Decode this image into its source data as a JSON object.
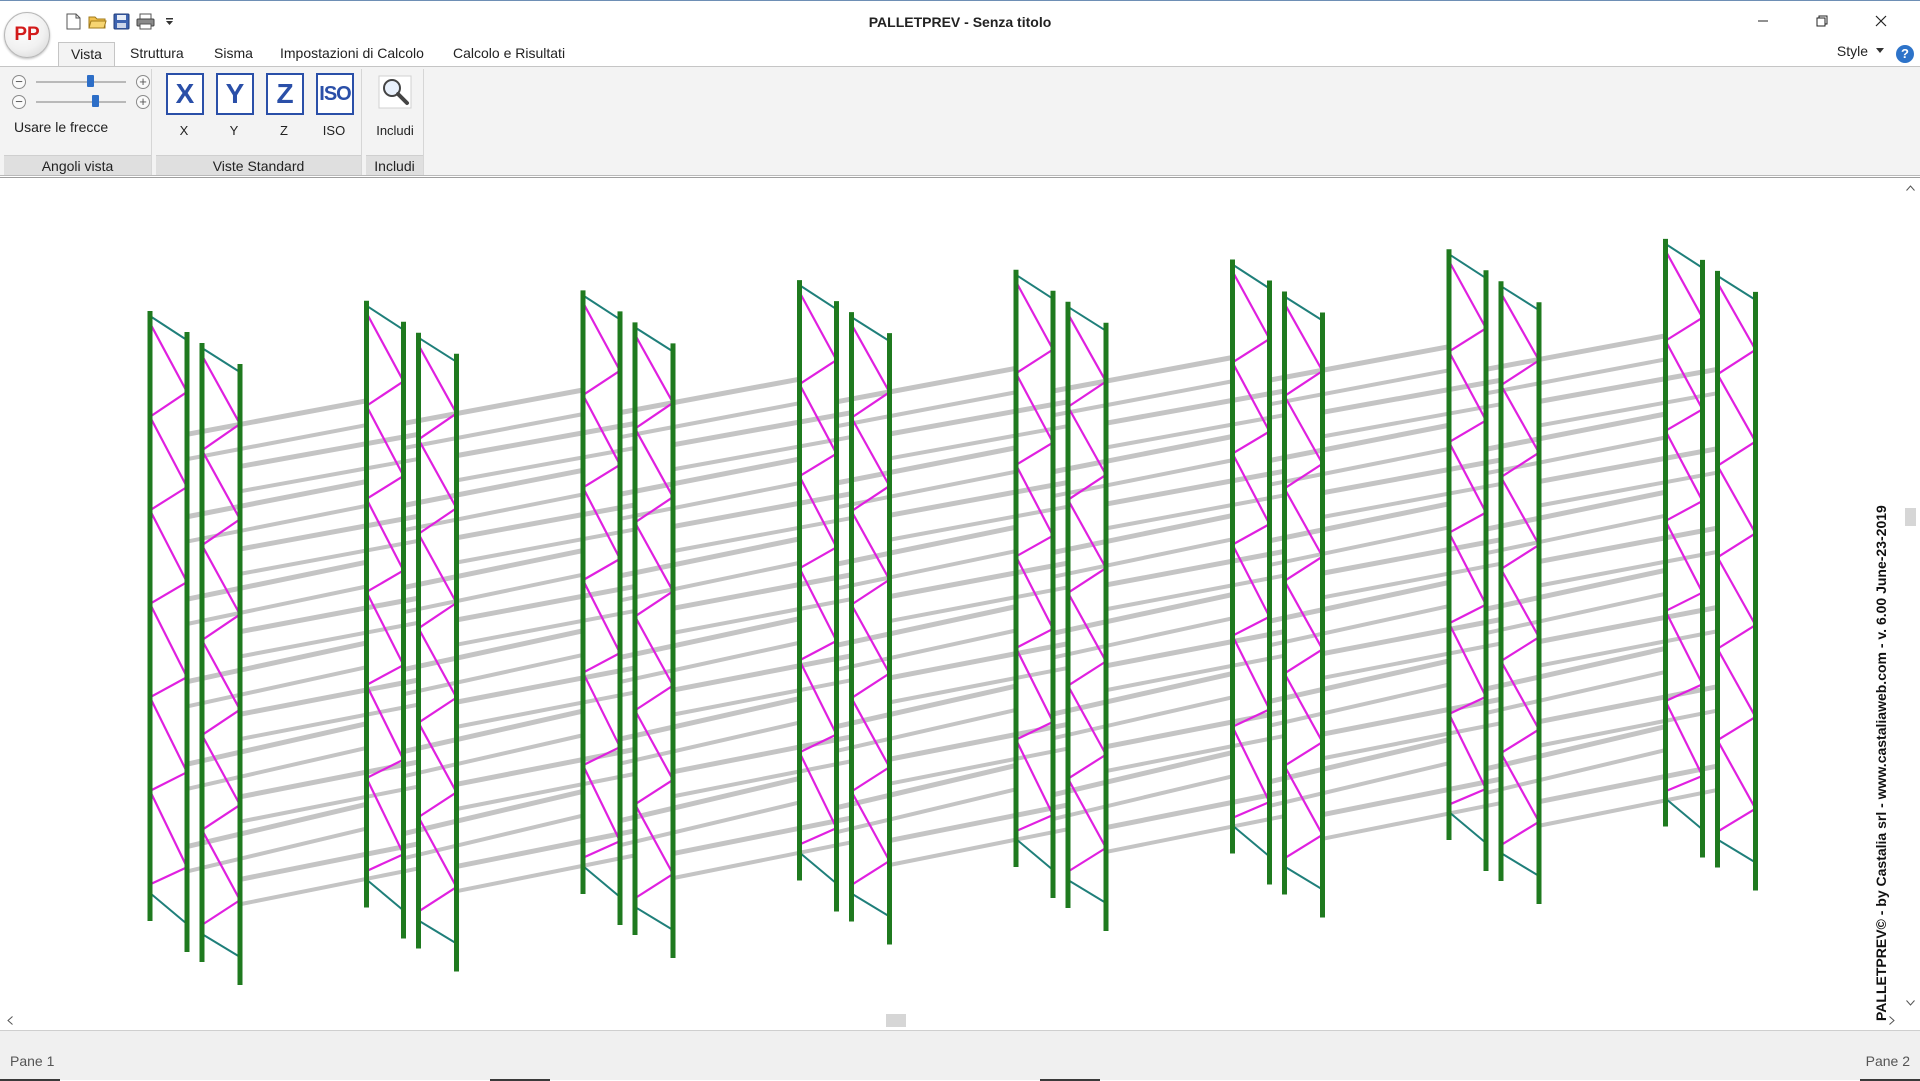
{
  "window": {
    "title": "PALLETPREV - Senza titolo",
    "logo": "PP"
  },
  "quick_access": [
    "new-document-icon",
    "open-folder-icon",
    "save-disk-icon",
    "print-icon",
    "dropdown-arrow-icon"
  ],
  "tabs": [
    {
      "id": "vista",
      "label": "Vista",
      "active": true
    },
    {
      "id": "struttura",
      "label": "Struttura"
    },
    {
      "id": "sisma",
      "label": "Sisma"
    },
    {
      "id": "impostazioni",
      "label": "Impostazioni di Calcolo"
    },
    {
      "id": "calcolo",
      "label": "Calcolo e Risultati"
    }
  ],
  "style_menu": {
    "label": "Style"
  },
  "ribbon": {
    "angoli_vista": {
      "label": "Angoli vista",
      "arrow_label": "Usare le frecce",
      "slider1_value": 0.6,
      "slider2_value": 0.66
    },
    "viste_standard": {
      "label": "Viste Standard",
      "buttons": [
        {
          "id": "x",
          "glyph": "X",
          "label": "X"
        },
        {
          "id": "y",
          "glyph": "Y",
          "label": "Y"
        },
        {
          "id": "z",
          "glyph": "Z",
          "label": "Z"
        },
        {
          "id": "iso",
          "glyph": "ISO",
          "label": "ISO"
        }
      ]
    },
    "includi": {
      "label": "Includi",
      "button_label": "Includi"
    }
  },
  "watermark": "PALLETPREV© - by Castalia srl - www.castaliaweb.com - v. 6.00 June-23-2019",
  "status": {
    "pane1": "Pane 1",
    "pane2": "Pane 2"
  },
  "colors": {
    "upright": "#1f7a1f",
    "brace": "#e020e0",
    "frame_top": "#1f7f7a",
    "beam": "#c4c4c4",
    "accent": "#2d6ec7"
  }
}
